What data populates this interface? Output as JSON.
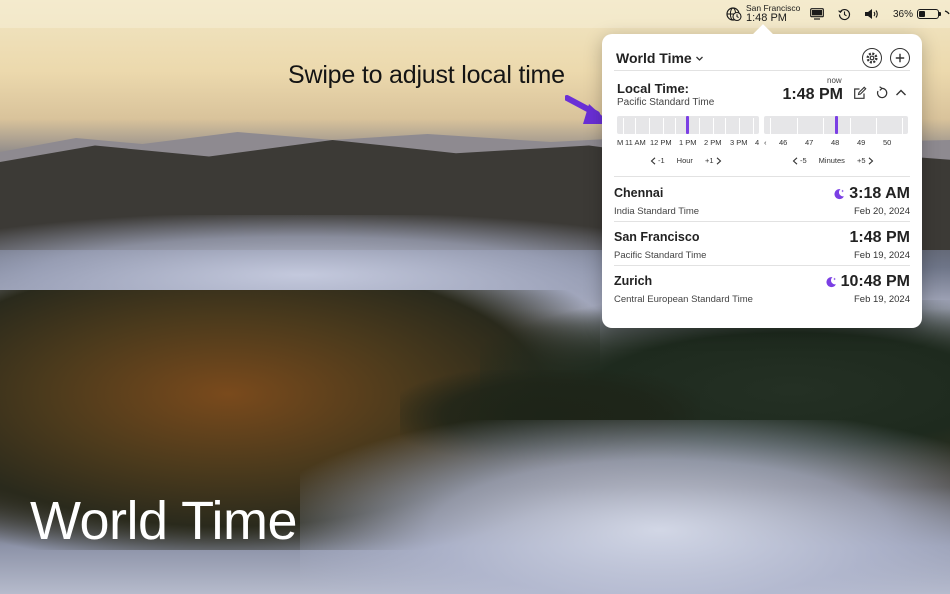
{
  "menubar": {
    "world_city": "San Francisco",
    "world_time": "1:48 PM",
    "battery_percent": "36%",
    "battery_level": 0.36,
    "icons": [
      "globe-clock-icon",
      "display-icon",
      "history-icon",
      "volume-icon",
      "battery-icon"
    ]
  },
  "captions": {
    "swipe": "Swipe to adjust local time",
    "title": "World Time"
  },
  "popover": {
    "title": "World Time",
    "settings_icon": "gear-icon",
    "add_icon": "plus-icon",
    "local": {
      "label": "Local Time:",
      "zone": "Pacific Standard Time",
      "now_tag": "now",
      "time": "1:48 PM",
      "icons": [
        "edit-icon",
        "reset-icon",
        "chevron-up-icon"
      ]
    },
    "hour_slider": {
      "labels": [
        "11 AM",
        "12 PM",
        "1 PM",
        "2 PM",
        "3 PM"
      ],
      "edge_left": "M",
      "edge_right": "4",
      "minus_label": "-1",
      "unit_label": "Hour",
      "plus_label": "+1"
    },
    "minute_slider": {
      "labels": [
        "46",
        "47",
        "48",
        "49",
        "50"
      ],
      "minus_label": "-5",
      "unit_label": "Minutes",
      "plus_label": "+5"
    },
    "cities": [
      {
        "name": "Chennai",
        "zone": "India Standard Time",
        "time": "3:18 AM",
        "date": "Feb 20, 2024",
        "night": true
      },
      {
        "name": "San Francisco",
        "zone": "Pacific Standard Time",
        "time": "1:48 PM",
        "date": "Feb 19, 2024",
        "night": false
      },
      {
        "name": "Zurich",
        "zone": "Central European Standard Time",
        "time": "10:48 PM",
        "date": "Feb 19, 2024",
        "night": true
      }
    ],
    "accent_color": "#7b3fe4"
  }
}
